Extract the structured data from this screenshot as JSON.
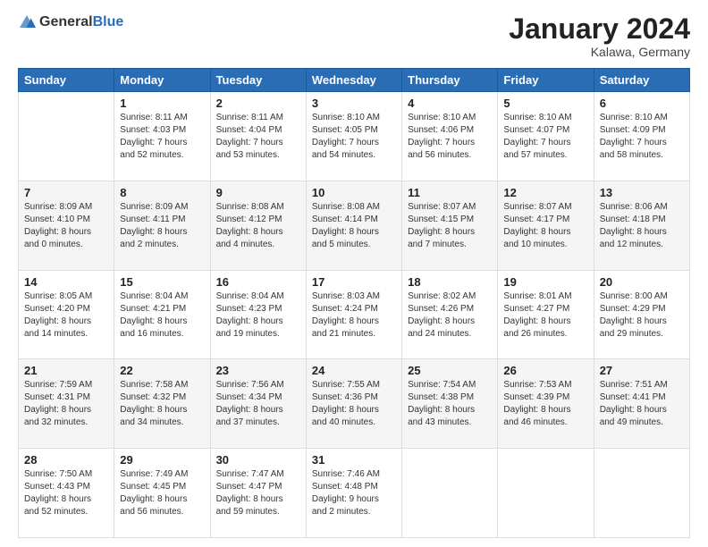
{
  "logo": {
    "general": "General",
    "blue": "Blue"
  },
  "title": "January 2024",
  "subtitle": "Kalawa, Germany",
  "days_header": [
    "Sunday",
    "Monday",
    "Tuesday",
    "Wednesday",
    "Thursday",
    "Friday",
    "Saturday"
  ],
  "weeks": [
    [
      {
        "day": "",
        "sunrise": "",
        "sunset": "",
        "daylight": ""
      },
      {
        "day": "1",
        "sunrise": "Sunrise: 8:11 AM",
        "sunset": "Sunset: 4:03 PM",
        "daylight": "Daylight: 7 hours and 52 minutes."
      },
      {
        "day": "2",
        "sunrise": "Sunrise: 8:11 AM",
        "sunset": "Sunset: 4:04 PM",
        "daylight": "Daylight: 7 hours and 53 minutes."
      },
      {
        "day": "3",
        "sunrise": "Sunrise: 8:10 AM",
        "sunset": "Sunset: 4:05 PM",
        "daylight": "Daylight: 7 hours and 54 minutes."
      },
      {
        "day": "4",
        "sunrise": "Sunrise: 8:10 AM",
        "sunset": "Sunset: 4:06 PM",
        "daylight": "Daylight: 7 hours and 56 minutes."
      },
      {
        "day": "5",
        "sunrise": "Sunrise: 8:10 AM",
        "sunset": "Sunset: 4:07 PM",
        "daylight": "Daylight: 7 hours and 57 minutes."
      },
      {
        "day": "6",
        "sunrise": "Sunrise: 8:10 AM",
        "sunset": "Sunset: 4:09 PM",
        "daylight": "Daylight: 7 hours and 58 minutes."
      }
    ],
    [
      {
        "day": "7",
        "sunrise": "Sunrise: 8:09 AM",
        "sunset": "Sunset: 4:10 PM",
        "daylight": "Daylight: 8 hours and 0 minutes."
      },
      {
        "day": "8",
        "sunrise": "Sunrise: 8:09 AM",
        "sunset": "Sunset: 4:11 PM",
        "daylight": "Daylight: 8 hours and 2 minutes."
      },
      {
        "day": "9",
        "sunrise": "Sunrise: 8:08 AM",
        "sunset": "Sunset: 4:12 PM",
        "daylight": "Daylight: 8 hours and 4 minutes."
      },
      {
        "day": "10",
        "sunrise": "Sunrise: 8:08 AM",
        "sunset": "Sunset: 4:14 PM",
        "daylight": "Daylight: 8 hours and 5 minutes."
      },
      {
        "day": "11",
        "sunrise": "Sunrise: 8:07 AM",
        "sunset": "Sunset: 4:15 PM",
        "daylight": "Daylight: 8 hours and 7 minutes."
      },
      {
        "day": "12",
        "sunrise": "Sunrise: 8:07 AM",
        "sunset": "Sunset: 4:17 PM",
        "daylight": "Daylight: 8 hours and 10 minutes."
      },
      {
        "day": "13",
        "sunrise": "Sunrise: 8:06 AM",
        "sunset": "Sunset: 4:18 PM",
        "daylight": "Daylight: 8 hours and 12 minutes."
      }
    ],
    [
      {
        "day": "14",
        "sunrise": "Sunrise: 8:05 AM",
        "sunset": "Sunset: 4:20 PM",
        "daylight": "Daylight: 8 hours and 14 minutes."
      },
      {
        "day": "15",
        "sunrise": "Sunrise: 8:04 AM",
        "sunset": "Sunset: 4:21 PM",
        "daylight": "Daylight: 8 hours and 16 minutes."
      },
      {
        "day": "16",
        "sunrise": "Sunrise: 8:04 AM",
        "sunset": "Sunset: 4:23 PM",
        "daylight": "Daylight: 8 hours and 19 minutes."
      },
      {
        "day": "17",
        "sunrise": "Sunrise: 8:03 AM",
        "sunset": "Sunset: 4:24 PM",
        "daylight": "Daylight: 8 hours and 21 minutes."
      },
      {
        "day": "18",
        "sunrise": "Sunrise: 8:02 AM",
        "sunset": "Sunset: 4:26 PM",
        "daylight": "Daylight: 8 hours and 24 minutes."
      },
      {
        "day": "19",
        "sunrise": "Sunrise: 8:01 AM",
        "sunset": "Sunset: 4:27 PM",
        "daylight": "Daylight: 8 hours and 26 minutes."
      },
      {
        "day": "20",
        "sunrise": "Sunrise: 8:00 AM",
        "sunset": "Sunset: 4:29 PM",
        "daylight": "Daylight: 8 hours and 29 minutes."
      }
    ],
    [
      {
        "day": "21",
        "sunrise": "Sunrise: 7:59 AM",
        "sunset": "Sunset: 4:31 PM",
        "daylight": "Daylight: 8 hours and 32 minutes."
      },
      {
        "day": "22",
        "sunrise": "Sunrise: 7:58 AM",
        "sunset": "Sunset: 4:32 PM",
        "daylight": "Daylight: 8 hours and 34 minutes."
      },
      {
        "day": "23",
        "sunrise": "Sunrise: 7:56 AM",
        "sunset": "Sunset: 4:34 PM",
        "daylight": "Daylight: 8 hours and 37 minutes."
      },
      {
        "day": "24",
        "sunrise": "Sunrise: 7:55 AM",
        "sunset": "Sunset: 4:36 PM",
        "daylight": "Daylight: 8 hours and 40 minutes."
      },
      {
        "day": "25",
        "sunrise": "Sunrise: 7:54 AM",
        "sunset": "Sunset: 4:38 PM",
        "daylight": "Daylight: 8 hours and 43 minutes."
      },
      {
        "day": "26",
        "sunrise": "Sunrise: 7:53 AM",
        "sunset": "Sunset: 4:39 PM",
        "daylight": "Daylight: 8 hours and 46 minutes."
      },
      {
        "day": "27",
        "sunrise": "Sunrise: 7:51 AM",
        "sunset": "Sunset: 4:41 PM",
        "daylight": "Daylight: 8 hours and 49 minutes."
      }
    ],
    [
      {
        "day": "28",
        "sunrise": "Sunrise: 7:50 AM",
        "sunset": "Sunset: 4:43 PM",
        "daylight": "Daylight: 8 hours and 52 minutes."
      },
      {
        "day": "29",
        "sunrise": "Sunrise: 7:49 AM",
        "sunset": "Sunset: 4:45 PM",
        "daylight": "Daylight: 8 hours and 56 minutes."
      },
      {
        "day": "30",
        "sunrise": "Sunrise: 7:47 AM",
        "sunset": "Sunset: 4:47 PM",
        "daylight": "Daylight: 8 hours and 59 minutes."
      },
      {
        "day": "31",
        "sunrise": "Sunrise: 7:46 AM",
        "sunset": "Sunset: 4:48 PM",
        "daylight": "Daylight: 9 hours and 2 minutes."
      },
      {
        "day": "",
        "sunrise": "",
        "sunset": "",
        "daylight": ""
      },
      {
        "day": "",
        "sunrise": "",
        "sunset": "",
        "daylight": ""
      },
      {
        "day": "",
        "sunrise": "",
        "sunset": "",
        "daylight": ""
      }
    ]
  ]
}
